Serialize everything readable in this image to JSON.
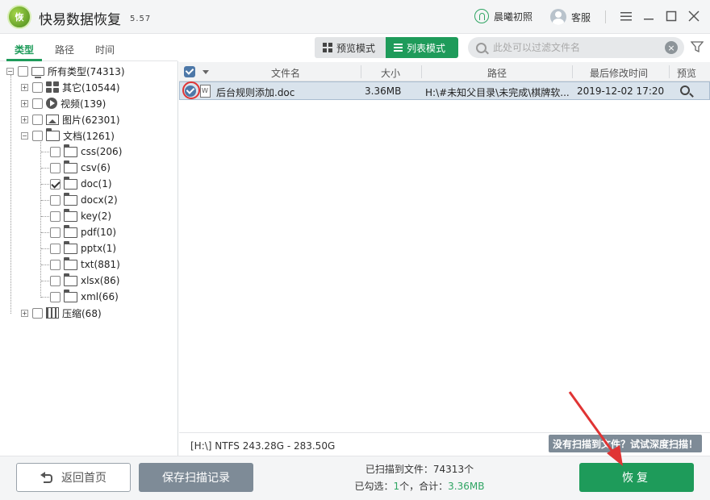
{
  "app": {
    "logo_text": "恢",
    "title": "快易数据恢复",
    "version": "5.57"
  },
  "header": {
    "user_name": "晨曦初照",
    "service_label": "客服"
  },
  "left_tabs": [
    {
      "label": "类型"
    },
    {
      "label": "路径"
    },
    {
      "label": "时间"
    }
  ],
  "tree": {
    "root": "所有类型(74313)",
    "other": "其它(10544)",
    "video": "视频(139)",
    "image": "图片(62301)",
    "docs": "文档(1261)",
    "doc_children": [
      "css(206)",
      "csv(6)",
      "doc(1)",
      "docx(2)",
      "key(2)",
      "pdf(10)",
      "pptx(1)",
      "txt(881)",
      "xlsx(86)",
      "xml(66)"
    ],
    "archive": "压缩(68)"
  },
  "view": {
    "preview_mode": "预览模式",
    "list_mode": "列表模式"
  },
  "search": {
    "placeholder": "此处可以过滤文件名"
  },
  "table": {
    "headers": {
      "name": "文件名",
      "size": "大小",
      "path": "路径",
      "modified": "最后修改时间",
      "preview": "预览"
    },
    "rows": [
      {
        "name": "后台规则添加.doc",
        "size": "3.36MB",
        "path": "H:\\#未知父目录\\未完成\\棋牌软...",
        "modified": "2019-12-02  17:20"
      }
    ]
  },
  "status": {
    "disk_info": "[H:\\] NTFS 243.28G - 283.50G",
    "deep_scan": "没有扫描到文件？试试深度扫描！"
  },
  "footer": {
    "back_label": "返回首页",
    "save_label": "保存扫描记录",
    "scanned_label": "已扫描到文件：",
    "scanned_count": "74313个",
    "selected_label": "已勾选：",
    "selected_count": "1",
    "selected_unit": "个，合计：",
    "selected_size": "3.36MB",
    "recover_label": "恢复"
  },
  "colors": {
    "accent": "#1e9b5a",
    "selection": "#d9e3ec",
    "annotation": "#e03434"
  }
}
